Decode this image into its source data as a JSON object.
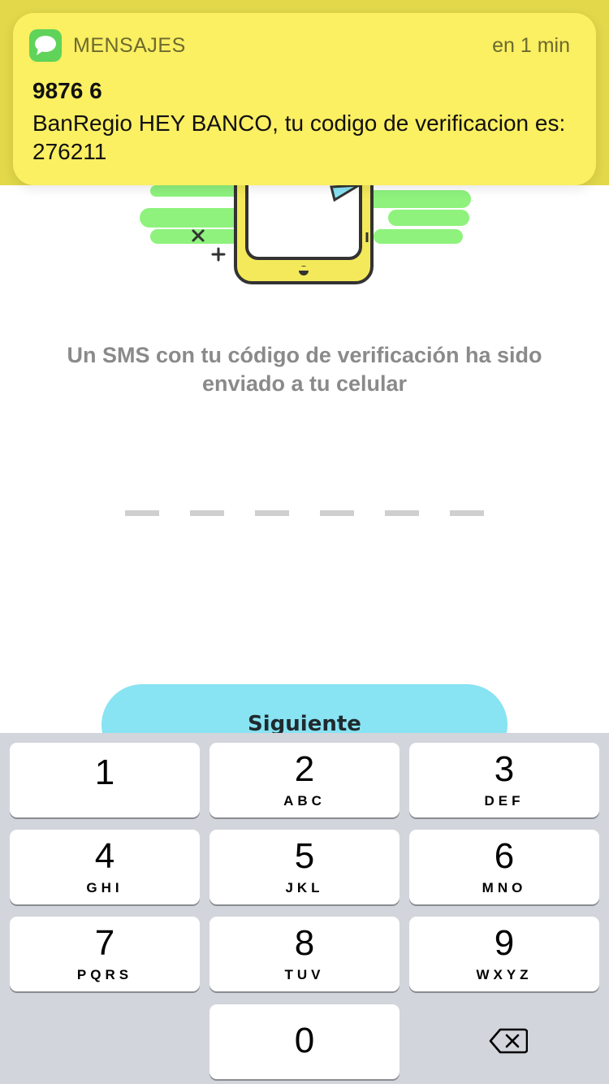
{
  "notification": {
    "app_name": "MENSAJES",
    "time": "en 1 min",
    "sender": "9876 6",
    "body": "BanRegio HEY BANCO, tu codigo de verificacion es: 276211",
    "icon": "messages-icon"
  },
  "screen": {
    "message": "Un SMS con tu código de verificación ha sido enviado a tu celular",
    "code_slots": 6,
    "next_label": "Siguiente"
  },
  "keypad": {
    "keys": [
      {
        "num": "1",
        "letters": ""
      },
      {
        "num": "2",
        "letters": "ABC"
      },
      {
        "num": "3",
        "letters": "DEF"
      },
      {
        "num": "4",
        "letters": "GHI"
      },
      {
        "num": "5",
        "letters": "JKL"
      },
      {
        "num": "6",
        "letters": "MNO"
      },
      {
        "num": "7",
        "letters": "PQRS"
      },
      {
        "num": "8",
        "letters": "TUV"
      },
      {
        "num": "9",
        "letters": "WXYZ"
      },
      {
        "num": "0",
        "letters": ""
      }
    ],
    "delete_icon": "backspace-icon"
  },
  "colors": {
    "notification_bg": "#fbef62",
    "button_bg": "#88e3f3",
    "illustration_green": "#8ef27d",
    "phone_yellow": "#f4e95a"
  }
}
